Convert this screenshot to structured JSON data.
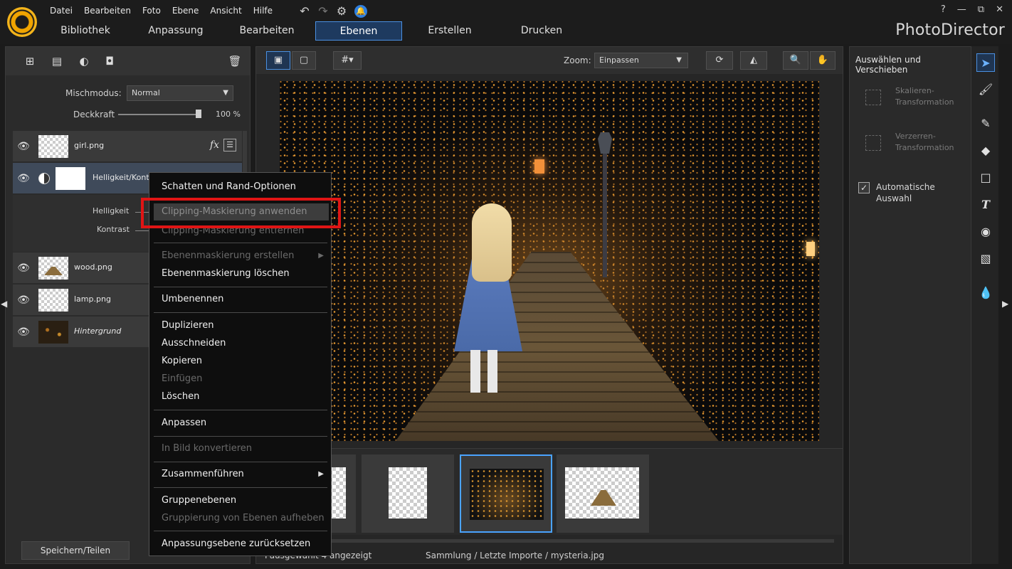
{
  "menu": [
    "Datei",
    "Bearbeiten",
    "Foto",
    "Ebene",
    "Ansicht",
    "Hilfe"
  ],
  "window_controls": [
    "?",
    "—",
    "⧉",
    "✕"
  ],
  "brand": "PhotoDirector",
  "tabs": [
    {
      "label": "Bibliothek"
    },
    {
      "label": "Anpassung"
    },
    {
      "label": "Bearbeiten"
    },
    {
      "label": "Ebenen",
      "active": true
    },
    {
      "label": "Erstellen"
    },
    {
      "label": "Drucken"
    }
  ],
  "layers_panel": {
    "blend_label": "Mischmodus:",
    "blend_value": "Normal",
    "opacity_label": "Deckkraft",
    "opacity_value": "100 %",
    "opacity_level": 1.0,
    "layers": [
      {
        "name": "girl.png"
      },
      {
        "name": "Helligkeit/Kont"
      },
      {
        "name": "wood.png"
      },
      {
        "name": "lamp.png"
      },
      {
        "name": "Hintergrund"
      }
    ],
    "adj_props": {
      "brightness": "Helligkeit",
      "contrast": "Kontrast"
    },
    "save_button": "Speichern/Teilen"
  },
  "center": {
    "zoom_label": "Zoom:",
    "zoom_value": "Einpassen",
    "status_left": "Pausgewählt   4 angezeigt",
    "status_path": "Sammlung / Letzte Importe / mysteria.jpg"
  },
  "right_panel": {
    "title": "Auswählen und Verschieben",
    "scale_label": "Skalieren-Transformation",
    "distort_label": "Verzerren-Transformation",
    "auto_select_label": "Automatische Auswahl",
    "auto_select_checked": true
  },
  "context_menu": {
    "items": [
      {
        "label": "Schatten und Rand-Optionen",
        "state": "enabled"
      },
      {
        "label": "Clipping-Maskierung anwenden",
        "state": "highlighted"
      },
      {
        "label": "Clipping-Maskierung entfernen",
        "state": "disabled"
      },
      {
        "label": "Ebenenmaskierung erstellen",
        "state": "disabled",
        "submenu": true
      },
      {
        "label": "Ebenenmaskierung löschen",
        "state": "enabled"
      },
      {
        "label": "Umbenennen",
        "state": "enabled"
      },
      {
        "label": "Duplizieren",
        "state": "enabled"
      },
      {
        "label": "Ausschneiden",
        "state": "enabled"
      },
      {
        "label": "Kopieren",
        "state": "enabled"
      },
      {
        "label": "Einfügen",
        "state": "disabled"
      },
      {
        "label": "Löschen",
        "state": "enabled"
      },
      {
        "label": "Anpassen",
        "state": "enabled"
      },
      {
        "label": "In Bild konvertieren",
        "state": "disabled"
      },
      {
        "label": "Zusammenführen",
        "state": "enabled",
        "submenu": true
      },
      {
        "label": "Gruppenebenen",
        "state": "enabled"
      },
      {
        "label": "Gruppierung von Ebenen aufheben",
        "state": "disabled"
      },
      {
        "label": "Anpassungsebene zurücksetzen",
        "state": "enabled"
      }
    ]
  },
  "icons": {
    "accent": "#4a90e2",
    "highlight_box": "#e01515"
  }
}
